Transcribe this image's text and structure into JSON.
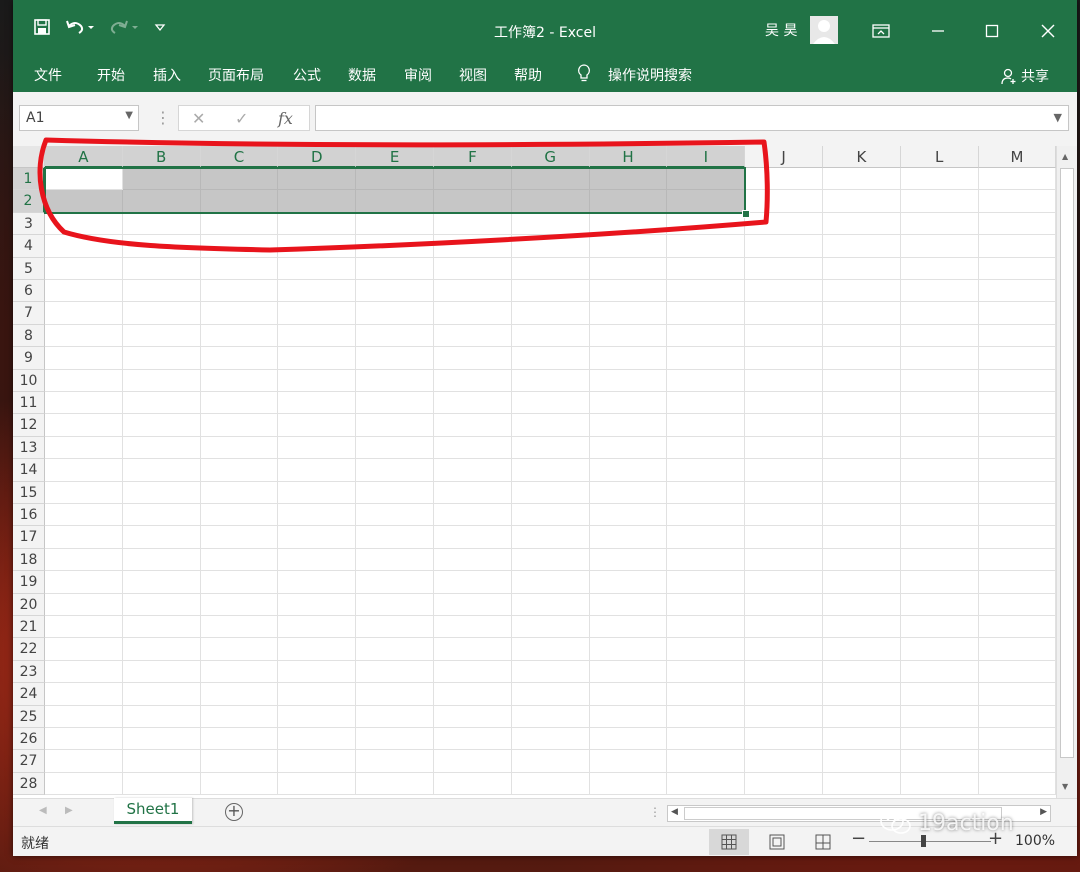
{
  "titlebar": {
    "title": "工作簿2 - Excel",
    "user": "吴 昊"
  },
  "ribbon": {
    "tabs": [
      "文件",
      "开始",
      "插入",
      "页面布局",
      "公式",
      "数据",
      "审阅",
      "视图",
      "帮助"
    ],
    "tell_me": "操作说明搜索",
    "share": "共享"
  },
  "formula_bar": {
    "name_box": "A1",
    "fx_label": "fx",
    "content": ""
  },
  "grid": {
    "columns": [
      "A",
      "B",
      "C",
      "D",
      "E",
      "F",
      "G",
      "H",
      "I",
      "J",
      "K",
      "L",
      "M"
    ],
    "rows": [
      "1",
      "2",
      "3",
      "4",
      "5",
      "6",
      "7",
      "8",
      "9",
      "10",
      "11",
      "12",
      "13",
      "14",
      "15",
      "16",
      "17",
      "18",
      "19",
      "20",
      "21",
      "22",
      "23",
      "24",
      "25",
      "26",
      "27",
      "28"
    ],
    "selection": "A1:I2"
  },
  "sheets": {
    "tabs": [
      "Sheet1"
    ],
    "active": "Sheet1"
  },
  "status": {
    "text": "就绪",
    "zoom": "100%"
  },
  "watermark": "19action",
  "colors": {
    "brand": "#217346",
    "selection": "#c6c6c6",
    "annotation": "#e8141c"
  }
}
